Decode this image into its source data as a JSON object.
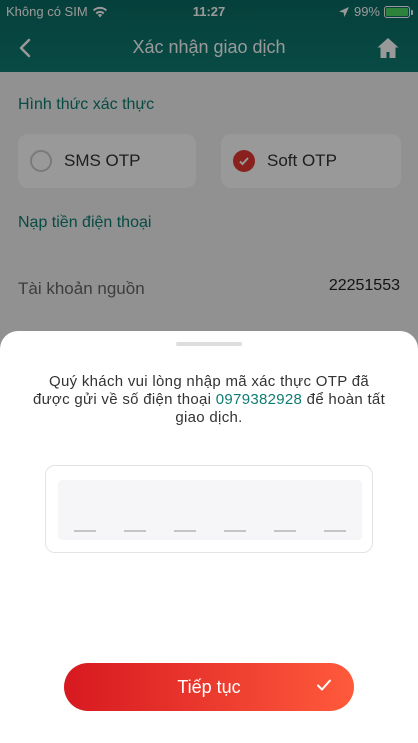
{
  "status_bar": {
    "carrier": "Không có SIM",
    "time": "11:27",
    "battery": "99%",
    "battery_level": 0.99,
    "icons": [
      "wifi-icon",
      "location-arrow-icon",
      "battery-icon"
    ]
  },
  "header": {
    "title": "Xác nhận giao dịch",
    "back_icon": "chevron-left-icon",
    "home_icon": "home-icon"
  },
  "auth": {
    "section_title": "Hình thức xác thực",
    "options": [
      {
        "label": "SMS OTP",
        "selected": false
      },
      {
        "label": "Soft OTP",
        "selected": true
      }
    ]
  },
  "topup": {
    "section_title": "Nạp tiền điện thoại",
    "source_label": "Tài khoản nguồn",
    "source_value": "22251553"
  },
  "sheet": {
    "message_before": "Quý khách vui lòng nhập mã xác thực OTP đã được gửi về số điện thoại ",
    "phone": "0979382928",
    "message_after": " để hoàn tất giao dịch.",
    "otp_length": 6,
    "continue_label": "Tiếp tục"
  },
  "colors": {
    "header": "#0f7d73",
    "accent": "#0e7c72",
    "button_start": "#d71920",
    "button_end": "#ff5a3c",
    "radio_checked": "#e53935"
  }
}
